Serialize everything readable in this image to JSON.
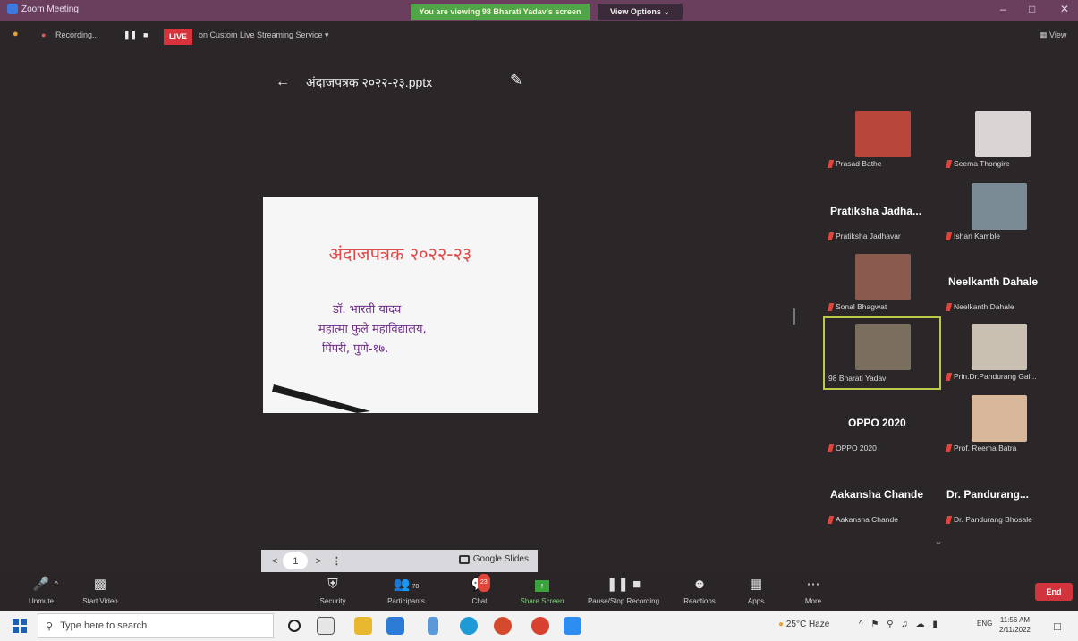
{
  "window": {
    "title": "Zoom Meeting",
    "banner": "You are viewing 98 Bharati Yadav's screen",
    "view_options": "View Options ⌄",
    "minimize": "–",
    "maximize": "□",
    "close": "✕"
  },
  "recbar": {
    "recording": "Recording...",
    "live": "LIVE",
    "streaming": "on Custom Live Streaming Service ▾",
    "view": "View"
  },
  "doc": {
    "filename": "अंदाजपत्रक २०२२-२३.pptx"
  },
  "slide": {
    "title": "अंदाजपत्रक २०२२-२३",
    "line1": "डॉ. भारती यादव",
    "line2": "महात्मा फुले महाविद्यालय,",
    "line3": "पिंपरी, पुणे-१७."
  },
  "slidenav": {
    "prev": "<",
    "page": "1",
    "next": ">",
    "more": "⋮",
    "app": "Google Slides"
  },
  "participants": [
    {
      "name": "Prasad Bathe",
      "big": "",
      "photo_color": "#b8463a"
    },
    {
      "name": "Seema Thongire",
      "big": "",
      "photo_color": "#d9d3d4"
    },
    {
      "name": "Pratiksha Jadhavar",
      "big": "Pratiksha Jadha...",
      "photo_color": ""
    },
    {
      "name": "Ishan Kamble",
      "big": "",
      "photo_color": "#7a8b96"
    },
    {
      "name": "Sonal Bhagwat",
      "big": "",
      "photo_color": "#8a5a4f"
    },
    {
      "name": "Neelkanth Dahale",
      "big": "Neelkanth Dahale",
      "photo_color": ""
    },
    {
      "name": "98 Bharati Yadav",
      "big": "",
      "photo_color": "#7a6f5e"
    },
    {
      "name": "Prin.Dr.Pandurang Gai...",
      "big": "",
      "photo_color": "#c9c0b2"
    },
    {
      "name": "OPPO 2020",
      "big": "OPPO 2020",
      "photo_color": ""
    },
    {
      "name": "Prof. Reema Batra",
      "big": "",
      "photo_color": "#d8b79b"
    },
    {
      "name": "Aakansha Chande",
      "big": "Aakansha Chande",
      "photo_color": ""
    },
    {
      "name": "Dr. Pandurang Bhosale",
      "big": "Dr. Pandurang...",
      "photo_color": ""
    }
  ],
  "gallery_more": "⌄",
  "toolbar": {
    "unmute": "Unmute",
    "start_video": "Start Video",
    "security": "Security",
    "participants": "Participants",
    "participants_count": "78",
    "chat": "Chat",
    "chat_badge": "23",
    "share_screen": "Share Screen",
    "recording": "Pause/Stop Recording",
    "reactions": "Reactions",
    "apps": "Apps",
    "more": "More",
    "end": "End"
  },
  "taskbar": {
    "search_placeholder": "Type here to search",
    "weather": "25°C  Haze",
    "lang": "ENG",
    "time": "11:56 AM",
    "date": "2/11/2022"
  },
  "colors": {
    "title_bar": "#6a3f5e",
    "banner_green": "#4fa548",
    "live_red": "#d8333b",
    "end_red": "#d2343d",
    "active_speaker": "#bcc84a",
    "slide_title": "#e14c4a",
    "slide_text": "#6d2d86"
  }
}
